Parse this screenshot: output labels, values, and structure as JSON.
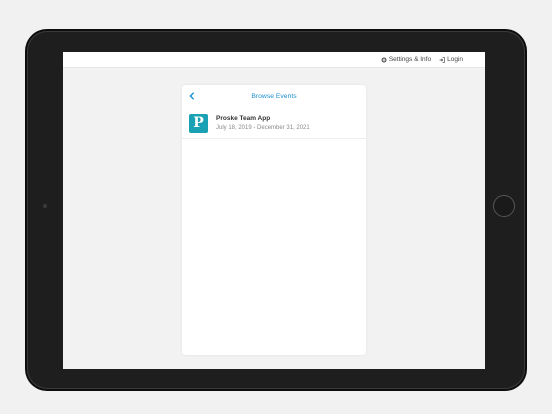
{
  "topbar": {
    "settings_label": "Settings & Info",
    "login_label": "Login"
  },
  "card": {
    "title": "Browse Events",
    "events": [
      {
        "logo_letter": "P",
        "name": "Proske Team App",
        "dates": "July 18, 2019 - December 31, 2021"
      }
    ]
  },
  "colors": {
    "accent": "#1c8fd1",
    "logo_bg": "#1aa1b4"
  },
  "icons": {
    "settings": "gear-icon",
    "login": "sign-in-icon",
    "back": "chevron-left-icon"
  }
}
